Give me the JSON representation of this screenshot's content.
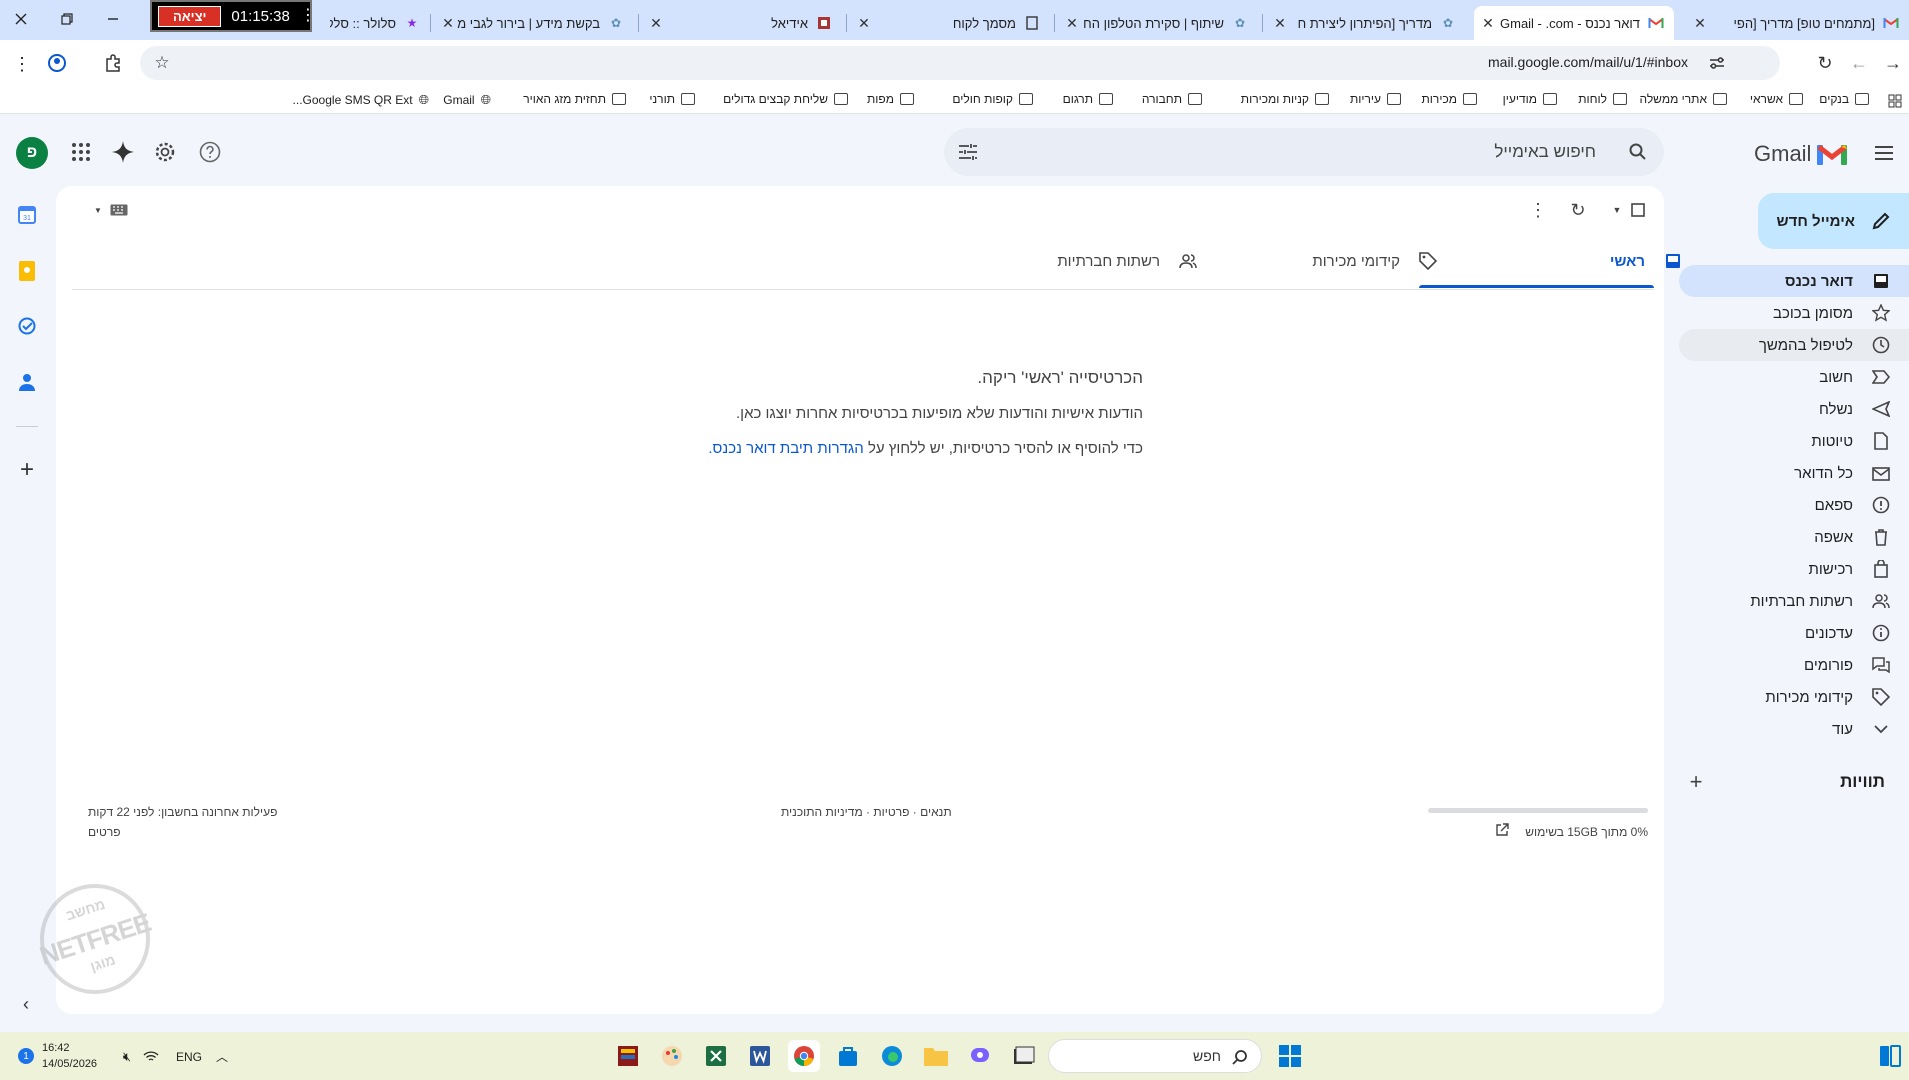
{
  "browser": {
    "tabs": [
      {
        "title": "[מתמחים טופ] מדריך [הפי",
        "favicon": "gmail-icon"
      },
      {
        "title": "דואר נכנס - Gmail - .com",
        "favicon": "gmail-icon",
        "active": true
      },
      {
        "title": "מדריך [הפיתרון ליצירת ח",
        "favicon": "openai-icon"
      },
      {
        "title": "שיתוף | סקירת הטלפון הח",
        "favicon": "openai-icon"
      },
      {
        "title": "מסמך לקוח",
        "favicon": "doc-icon"
      },
      {
        "title": "אידיאל",
        "favicon": "site-icon"
      },
      {
        "title": "בקשת מידע | בירור לגבי מ",
        "favicon": "openai-icon"
      },
      {
        "title": "סלולר :: סלקום",
        "favicon": "star-icon"
      }
    ],
    "timer": "01:15:38",
    "exit_label": "יציאה",
    "url": "mail.google.com/mail/u/1/#inbox",
    "bookmarks": [
      "בנקים",
      "אשראי",
      "אתרי ממשלה",
      "לוחות",
      "מודיעין",
      "מכירות",
      "עיריות",
      "קניות ומכירות",
      "תחבורה",
      "תרגום",
      "קופות חולים",
      "מפות",
      "שליחת קבצים גדולים",
      "תורני",
      "תחזית מזג האויר",
      "Gmail",
      "Google SMS QR Ext..."
    ]
  },
  "gmail": {
    "logo_text": "Gmail",
    "search_placeholder": "חיפוש באימייל",
    "avatar_letter": "פ",
    "compose_label": "אימייל חדש",
    "nav": [
      {
        "label": "דואר נכנס",
        "icon": "inbox-icon",
        "selected": true
      },
      {
        "label": "מסומן בכוכב",
        "icon": "star-icon"
      },
      {
        "label": "לטיפול בהמשך",
        "icon": "clock-icon",
        "hover": true
      },
      {
        "label": "חשוב",
        "icon": "important-icon"
      },
      {
        "label": "נשלח",
        "icon": "send-icon"
      },
      {
        "label": "טיוטות",
        "icon": "draft-icon"
      },
      {
        "label": "כל הדואר",
        "icon": "all-mail-icon"
      },
      {
        "label": "ספאם",
        "icon": "spam-icon"
      },
      {
        "label": "אשפה",
        "icon": "trash-icon"
      },
      {
        "label": "רכישות",
        "icon": "purchases-icon"
      },
      {
        "label": "רשתות חברתיות",
        "icon": "social-icon"
      },
      {
        "label": "עדכונים",
        "icon": "updates-icon"
      },
      {
        "label": "פורומים",
        "icon": "forums-icon"
      },
      {
        "label": "קידומי מכירות",
        "icon": "promotions-icon"
      },
      {
        "label": "עוד",
        "icon": "chevron-down-icon"
      }
    ],
    "labels_heading": "תוויות",
    "category_tabs": [
      {
        "label": "ראשי",
        "icon": "inbox-icon",
        "active": true
      },
      {
        "label": "קידומי מכירות",
        "icon": "tag-icon"
      },
      {
        "label": "רשתות חברתיות",
        "icon": "social-icon"
      }
    ],
    "empty": {
      "title": "הכרטיסייה 'ראשי' ריקה.",
      "line1": "הודעות אישיות והודעות שלא מופיעות בכרטיסיות אחרות יוצגו כאן.",
      "line2_prefix": "כדי להוסיף או להסיר כרטיסיות, יש ללחוץ על",
      "line2_link": "הגדרות תיבת דואר נכנס",
      "line2_suffix": "."
    },
    "footer": {
      "storage": "0% מתוך 15GB בשימוש",
      "storage_fraction": 0.0,
      "terms": "תנאים · פרטיות · מדיניות התוכנית",
      "last_activity": "פעילות אחרונה בחשבון: לפני 22 דקות",
      "details": "פרטים"
    }
  },
  "taskbar": {
    "time": "16:42",
    "date": "14/05/2026",
    "lang": "ENG",
    "search_placeholder": "חפש",
    "notification_count": "1"
  },
  "watermark": {
    "line1": "מחשב",
    "line2": "NETFREE",
    "line3": "מוגן"
  },
  "colors": {
    "accent": "#0b57d0",
    "selected_nav": "#d3e3fd",
    "compose": "#c2e7ff",
    "tabbar": "#d3e3fd",
    "exit": "#d93025"
  }
}
